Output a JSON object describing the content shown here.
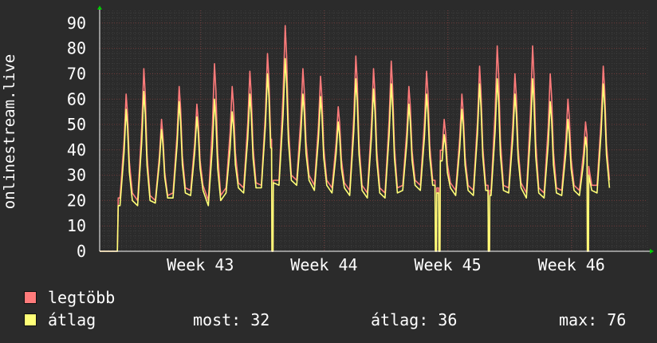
{
  "chart_data": {
    "type": "line",
    "ylabel": "onlinestream.live",
    "yticks": [
      0,
      10,
      20,
      30,
      40,
      50,
      60,
      70,
      80,
      90
    ],
    "ylim": [
      0,
      95
    ],
    "xlim": [
      0,
      31
    ],
    "xticks": [
      {
        "label": "Week 43",
        "x": 5.7
      },
      {
        "label": "Week 44",
        "x": 12.7
      },
      {
        "label": "Week 45",
        "x": 19.7
      },
      {
        "label": "Week 46",
        "x": 26.7
      }
    ],
    "grid": true,
    "colors": {
      "background": "#2b2b2b",
      "axis": "#ffffff",
      "grid_major": "#6e3a3a",
      "grid_minor": "#3d3d3d",
      "arrow": "#00cc00"
    },
    "series": [
      {
        "name": "legtöbb",
        "color": "#ff7b7b",
        "day_peaks": [
          62,
          72,
          52,
          65,
          58,
          74,
          65,
          71,
          78,
          89,
          72,
          69,
          57,
          77,
          72,
          75,
          65,
          71,
          52,
          62,
          73,
          81,
          70,
          81,
          70,
          60,
          51,
          73
        ],
        "day_troughs": [
          21,
          20,
          20,
          23,
          24,
          20,
          25,
          25,
          26,
          28,
          28,
          26,
          25,
          24,
          23,
          23,
          26,
          26,
          25,
          24,
          24,
          24,
          25,
          23,
          23,
          24,
          24,
          26
        ]
      },
      {
        "name": "átlag",
        "color": "#ffff77",
        "day_peaks": [
          56,
          63,
          48,
          59,
          53,
          60,
          55,
          62,
          70,
          76,
          62,
          61,
          51,
          68,
          64,
          66,
          58,
          62,
          46,
          56,
          66,
          68,
          62,
          68,
          59,
          52,
          45,
          66
        ],
        "day_troughs": [
          18,
          18,
          19,
          21,
          22,
          18,
          23,
          23,
          25,
          26,
          26,
          24,
          23,
          22,
          21,
          21,
          24,
          24,
          23,
          22,
          22,
          22,
          23,
          21,
          21,
          22,
          22,
          23
        ]
      }
    ],
    "legend": {
      "position": "bottom-left"
    }
  },
  "legend": {
    "max_label": "legtöbb",
    "avg_label": "átlag",
    "now_text": "most: 32",
    "avg_text": "átlag: 36",
    "max_text": "max: 76",
    "max_color": "#ff7b7b",
    "avg_color": "#ffff77"
  }
}
